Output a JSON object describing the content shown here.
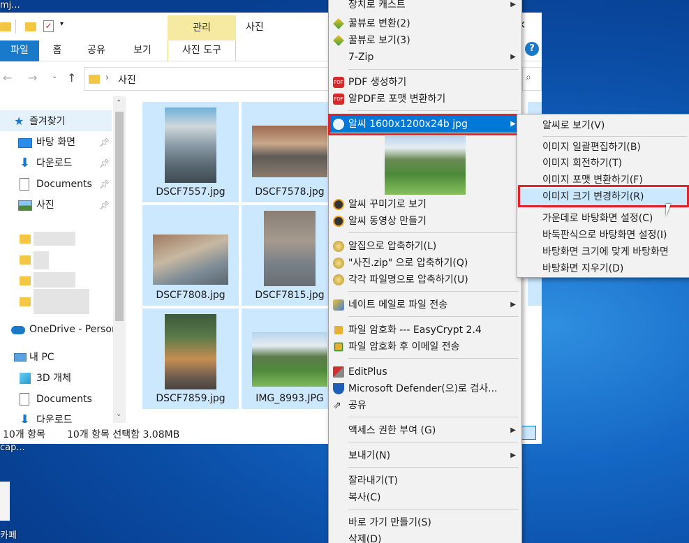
{
  "desktop": {
    "top_left_text": "mj...",
    "cap_text": "cap...",
    "bottom_text": "카페"
  },
  "explorer": {
    "ribbon": {
      "manage_label": "관리",
      "title": "사진",
      "tabs": [
        "파일",
        "홈",
        "공유",
        "보기",
        "사진 도구"
      ]
    },
    "address": {
      "folder": "사진"
    },
    "nav": {
      "items": [
        {
          "label": "즐겨찾기",
          "icon": "star-icon"
        },
        {
          "label": "바탕 화면",
          "icon": "desktop-icon",
          "pinned": true
        },
        {
          "label": "다운로드",
          "icon": "download-icon",
          "pinned": true
        },
        {
          "label": "Documents",
          "icon": "document-icon",
          "pinned": true
        },
        {
          "label": "사진",
          "icon": "pictures-icon",
          "pinned": true
        },
        {
          "label": "OneDrive - Person",
          "icon": "onedrive-icon"
        },
        {
          "label": "내 PC",
          "icon": "pc-icon"
        },
        {
          "label": "3D 개체",
          "icon": "cube-icon"
        },
        {
          "label": "Documents",
          "icon": "document-icon"
        },
        {
          "label": "다운로드",
          "icon": "download-icon"
        }
      ]
    },
    "files": [
      "DSCF7557.jpg",
      "DSCF7578.jpg",
      "DSCF7808.jpg",
      "DSCF7815.jpg",
      "DSCF7859.jpg",
      "IMG_8993.JPG"
    ],
    "status": {
      "count": "10개 항목",
      "selected": "10개 항목 선택함 3.08MB"
    }
  },
  "context_menu": {
    "items": [
      {
        "label": "장치로 캐스트",
        "submenu": true
      },
      {
        "label": "꿀뷰로 변환(2)",
        "icon": "honeyview-icon"
      },
      {
        "label": "꿀뷰로 보기(3)",
        "icon": "honeyview-icon"
      },
      {
        "label": "7-Zip",
        "submenu": true
      },
      {
        "label": "PDF 생성하기",
        "icon": "pdf-icon"
      },
      {
        "label": "알PDF로 포맷 변환하기",
        "icon": "pdf-icon"
      },
      {
        "label": "알씨 1600x1200x24b jpg",
        "icon": "alsee-icon",
        "submenu": true,
        "selected": true
      },
      {
        "label": "알씨 꾸미기로 보기",
        "icon": "alsee-deco-icon"
      },
      {
        "label": "알씨 동영상 만들기",
        "icon": "alsee-movie-icon"
      },
      {
        "label": "알집으로 압축하기(L)",
        "icon": "alzip-icon"
      },
      {
        "label": "\"사진.zip\" 으로 압축하기(Q)",
        "icon": "alzip-icon"
      },
      {
        "label": "각각 파일명으로 압축하기(U)",
        "icon": "alzip-icon"
      },
      {
        "label": "네이트 메일로 파일 전송",
        "icon": "nate-icon",
        "submenu": true
      },
      {
        "label": "파일 암호화 --- EasyCrypt 2.4",
        "icon": "lock-icon"
      },
      {
        "label": "파일 암호화 후 이메일 전송",
        "icon": "lock-mail-icon"
      },
      {
        "label": "EditPlus",
        "icon": "editplus-icon"
      },
      {
        "label": "Microsoft Defender(으)로 검사...",
        "icon": "defender-icon"
      },
      {
        "label": "공유",
        "icon": "share-icon"
      },
      {
        "label": "액세스 권한 부여 (G)",
        "submenu": true
      },
      {
        "label": "보내기(N)",
        "submenu": true
      },
      {
        "label": "잘라내기(T)"
      },
      {
        "label": "복사(C)"
      },
      {
        "label": "바로 가기 만들기(S)"
      },
      {
        "label": "삭제(D)"
      }
    ]
  },
  "submenu": {
    "items": [
      "알씨로 보기(V)",
      "이미지 일괄편집하기(B)",
      "이미지 회전하기(T)",
      "이미지 포맷 변환하기(F)",
      "이미지 크기 변경하기(R)",
      "가운데로 바탕화면 설정(C)",
      "바둑판식으로 바탕화면 설정(I)",
      "바탕화면 크기에 맞게 바탕화면",
      "바탕화면 지우기(D)"
    ]
  },
  "colors": {
    "selection_blue": "#0078d7",
    "tile_selected": "#cce8ff",
    "highlight_red": "#e0242b",
    "manage_tab": "#f6eaa3",
    "file_tab": "#1979ca"
  }
}
